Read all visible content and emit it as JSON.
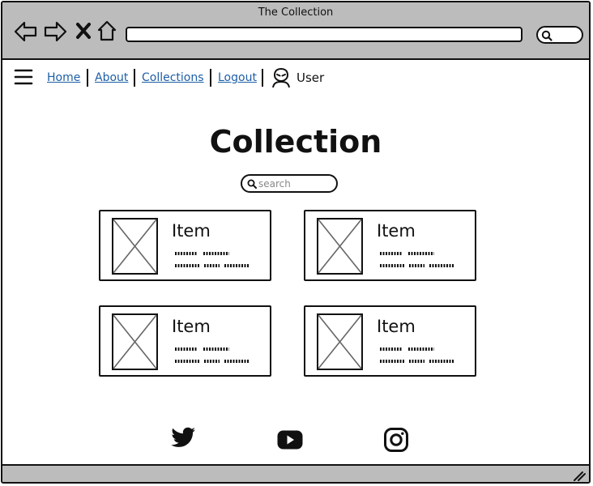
{
  "window": {
    "title": "The Collection",
    "address_value": "",
    "search_value": ""
  },
  "nav": {
    "links": [
      {
        "label": "Home"
      },
      {
        "label": "About"
      },
      {
        "label": "Collections"
      },
      {
        "label": "Logout"
      }
    ],
    "user_label": "User",
    "link_color": "#1d5fa6"
  },
  "main": {
    "title": "Collection",
    "search_placeholder": "search",
    "cards": [
      {
        "title": "Item",
        "icon": "image-placeholder-icon"
      },
      {
        "title": "Item",
        "icon": "image-placeholder-icon"
      },
      {
        "title": "Item",
        "icon": "image-placeholder-icon"
      },
      {
        "title": "Item",
        "icon": "image-placeholder-icon"
      }
    ]
  },
  "footer": {
    "social": [
      {
        "icon": "twitter-icon"
      },
      {
        "icon": "youtube-icon"
      },
      {
        "icon": "instagram-icon"
      }
    ]
  },
  "colors": {
    "chrome": "#bcbcbc",
    "stroke": "#111111"
  }
}
